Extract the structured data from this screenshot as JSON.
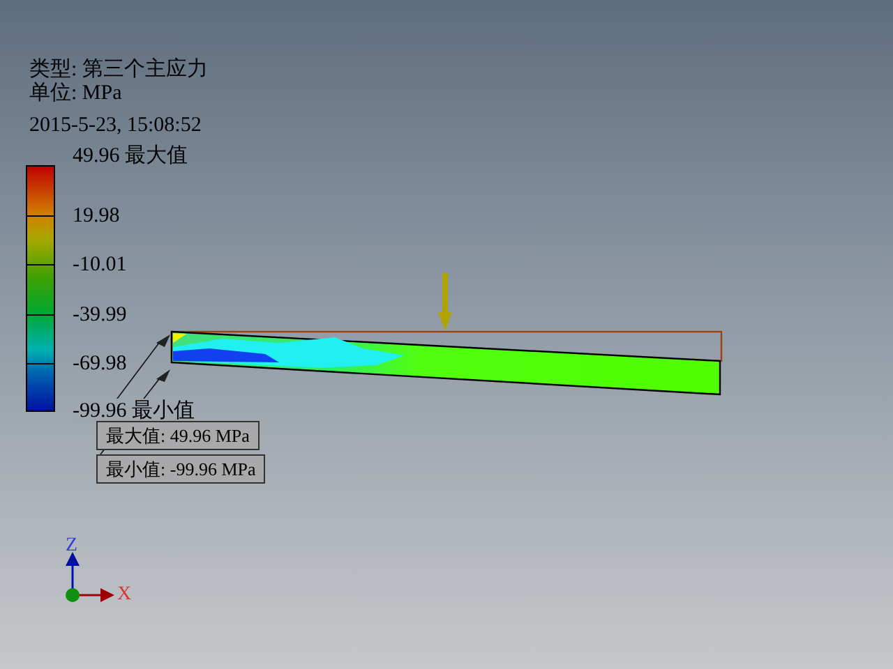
{
  "header": {
    "type_line": "类型: 第三个主应力",
    "unit_line": "单位: MPa",
    "timestamp": "2015-5-23, 15:08:52"
  },
  "legend": {
    "labels": [
      "49.96 最大值",
      "19.98",
      "-10.01",
      "-39.99",
      "-69.98",
      "-99.96 最小值"
    ]
  },
  "callouts": [
    {
      "text": "最大值: 49.96 MPa"
    },
    {
      "text": "最小值: -99.96 MPa"
    }
  ],
  "triad": {
    "z_label": "Z",
    "x_label": "X"
  }
}
